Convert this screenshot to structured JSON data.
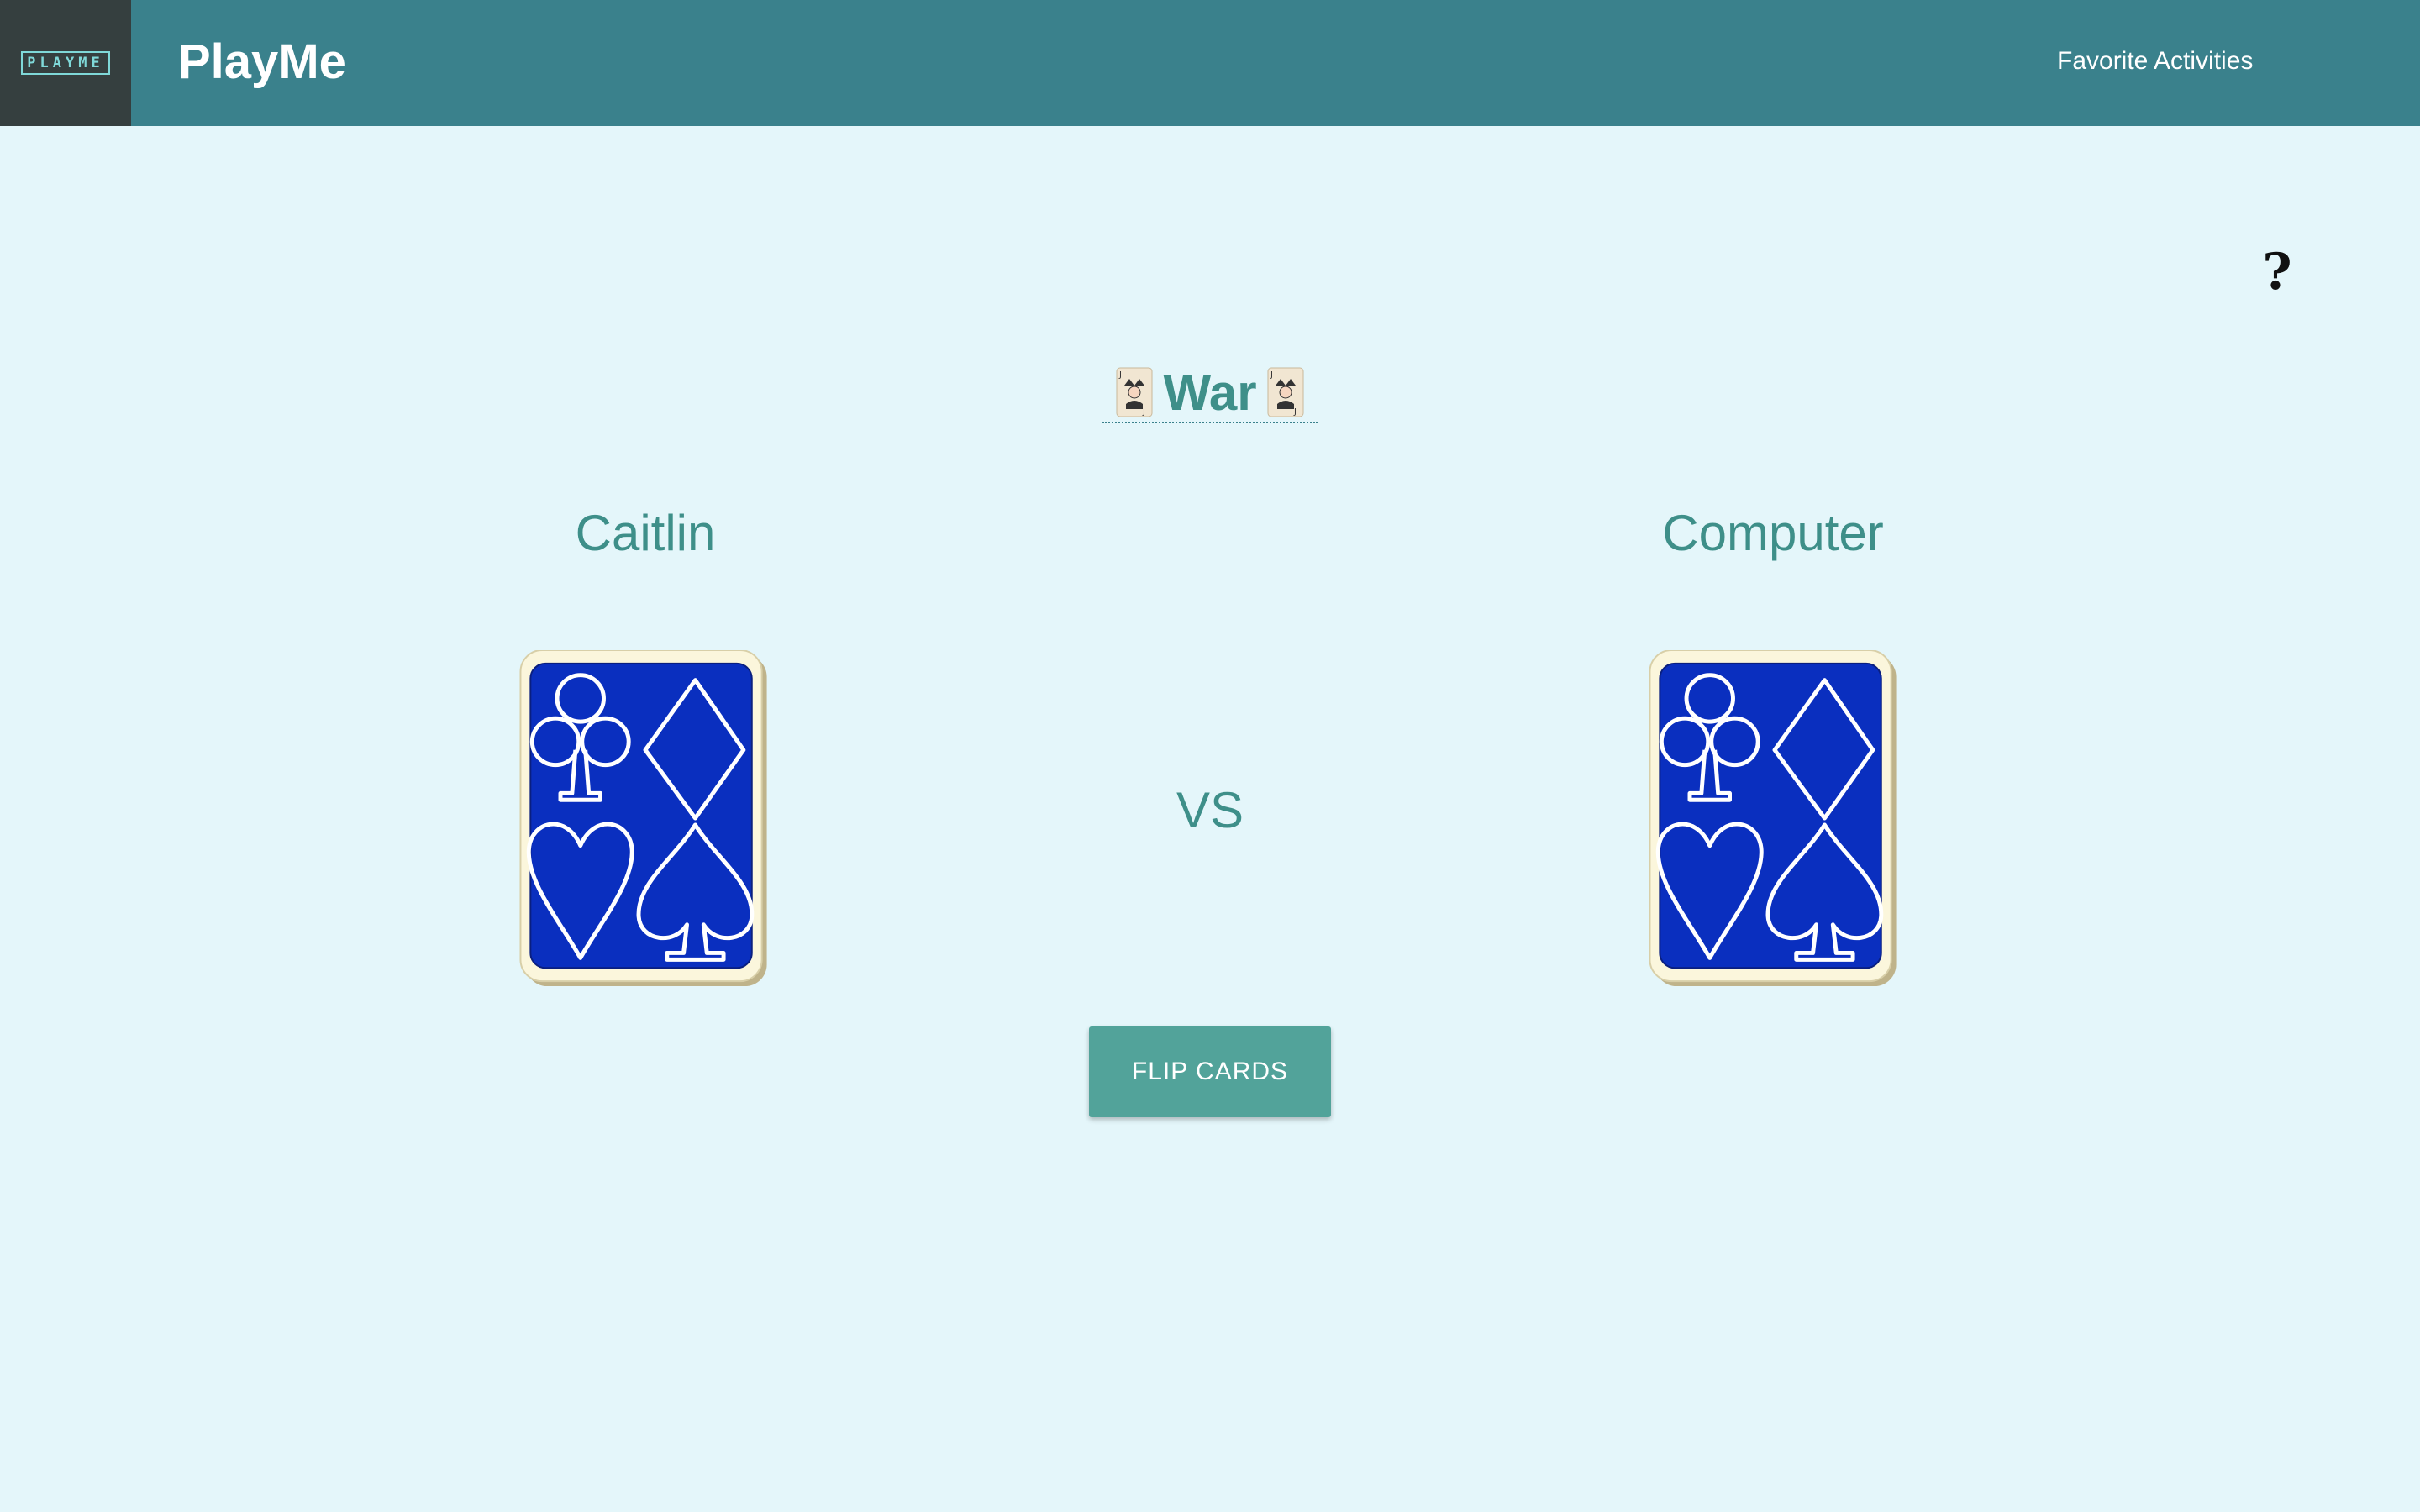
{
  "header": {
    "logo_text": "PLAYME",
    "app_title": "PlayMe",
    "nav_link": "Favorite Activities"
  },
  "help": {
    "icon": "question-mark-icon",
    "symbol": "?"
  },
  "game": {
    "title": "War",
    "title_decoration_icon": "joker-card-icon"
  },
  "players": {
    "left_name": "Caitlin",
    "right_name": "Computer"
  },
  "vs_label": "VS",
  "flip_button_label": "FLIP CARDS",
  "colors": {
    "navbar": "#3a818c",
    "logo_bg": "#353f3f",
    "page_bg": "#e4f6fa",
    "accent_text": "#3e8f89",
    "button_bg": "#52a39a",
    "card_blue": "#0a2fbf",
    "card_border": "#fbf6dc"
  }
}
